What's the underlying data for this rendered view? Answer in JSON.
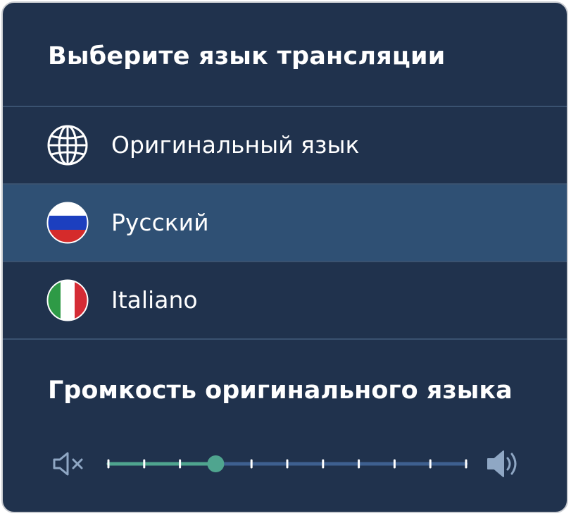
{
  "language_section": {
    "title": "Выберите язык трансляции",
    "options": [
      {
        "label": "Оригинальный язык",
        "icon": "globe-icon",
        "selected": false
      },
      {
        "label": "Русский",
        "icon": "russia-flag-icon",
        "selected": true
      },
      {
        "label": "Italiano",
        "icon": "italy-flag-icon",
        "selected": false
      }
    ]
  },
  "volume_section": {
    "title": "Громкость оригинального языка",
    "level_fraction": 0.3,
    "mute_icon": "volume-mute-icon",
    "max_icon": "volume-high-icon"
  },
  "colors": {
    "panel_bg": "#20324d",
    "selected_row_bg": "#2f5074",
    "slider_active": "#4fa58f",
    "slider_track": "#3e6090",
    "icon_muted": "#8fa7c4"
  }
}
